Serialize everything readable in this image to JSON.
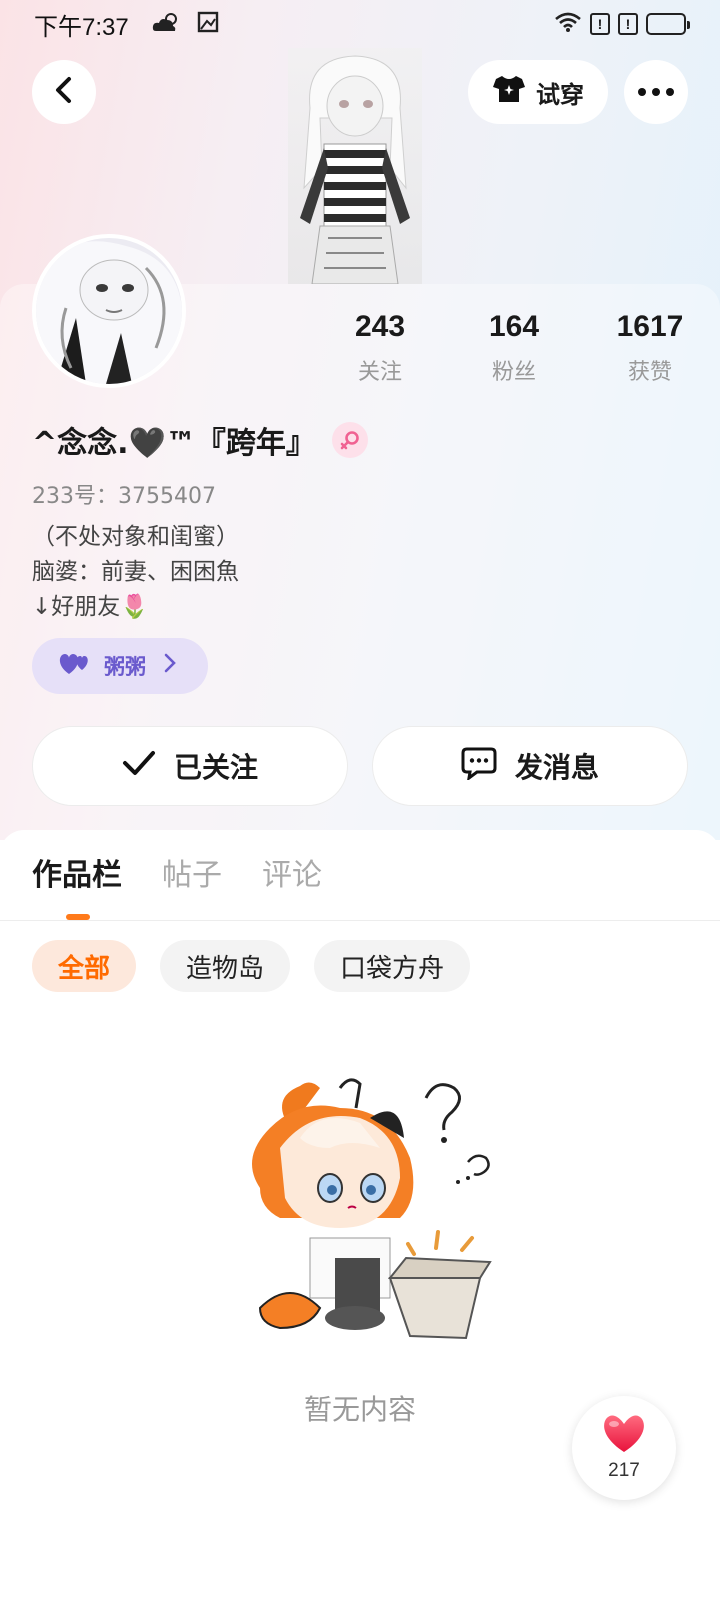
{
  "status_bar": {
    "time": "下午7:37"
  },
  "header": {
    "tryon_label": "试穿",
    "back_icon": "chevron-left-icon",
    "more_icon": "more-dots-icon"
  },
  "profile": {
    "username": "^念念.🖤™『跨年』",
    "gender": "female",
    "uid_line": "233号：3755407",
    "bio": [
      "（不处对象和闺蜜）",
      "脑婆：前妻、困困魚",
      "↓好朋友🌷"
    ],
    "friend_chip_label": "粥粥",
    "stats": [
      {
        "value": "243",
        "label": "关注"
      },
      {
        "value": "164",
        "label": "粉丝"
      },
      {
        "value": "1617",
        "label": "获赞"
      }
    ]
  },
  "actions": {
    "follow_label": "已关注",
    "message_label": "发消息"
  },
  "content": {
    "tabs": [
      "作品栏",
      "帖子",
      "评论"
    ],
    "active_tab": "作品栏",
    "filters": [
      "全部",
      "造物岛",
      "口袋方舟"
    ],
    "active_filter": "全部",
    "empty_text": "暂无内容"
  },
  "like_fab": {
    "count": "217"
  },
  "colors": {
    "accent": "#ff7a1a",
    "chip_active_bg": "#fde8dc",
    "friend_chip_bg": "#e6e0f8",
    "heart": "#ff3b5c"
  }
}
